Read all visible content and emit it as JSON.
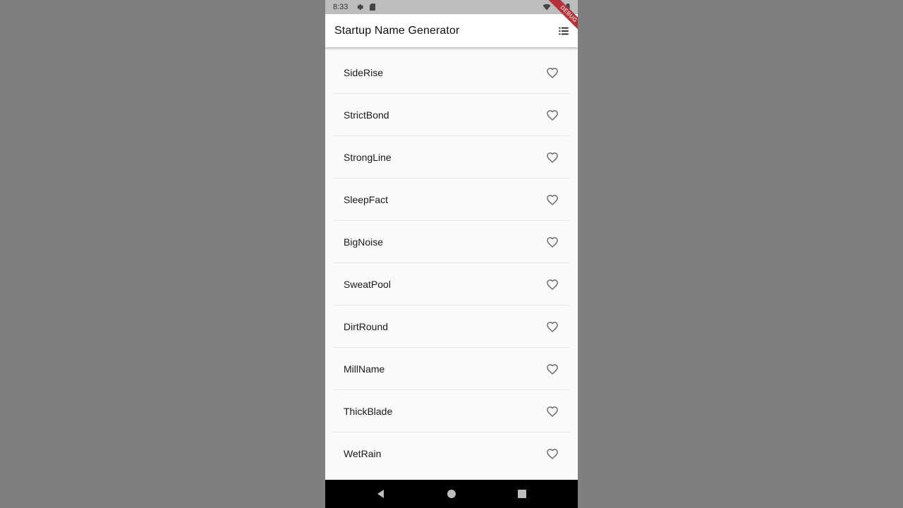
{
  "status_bar": {
    "time": "8:33",
    "icons": [
      "settings-icon",
      "sd-card-icon",
      "wifi-icon",
      "battery-icon"
    ]
  },
  "app_bar": {
    "title": "Startup Name Generator",
    "action_icon": "list-icon",
    "debug_banner": "DEBUG"
  },
  "names": [
    {
      "label": "SideRise"
    },
    {
      "label": "StrictBond"
    },
    {
      "label": "StrongLine"
    },
    {
      "label": "SleepFact"
    },
    {
      "label": "BigNoise"
    },
    {
      "label": "SweatPool"
    },
    {
      "label": "DirtRound"
    },
    {
      "label": "MillName"
    },
    {
      "label": "ThickBlade"
    },
    {
      "label": "WetRain"
    }
  ],
  "row_icon": "heart-outline-icon",
  "nav_bar": {
    "icons": [
      "back-icon",
      "home-icon",
      "recents-icon"
    ]
  },
  "colors": {
    "backdrop": "#7f7f7f",
    "list_background": "#fafafa",
    "banner": "#b3343a",
    "icon": "#6d6d6d"
  }
}
